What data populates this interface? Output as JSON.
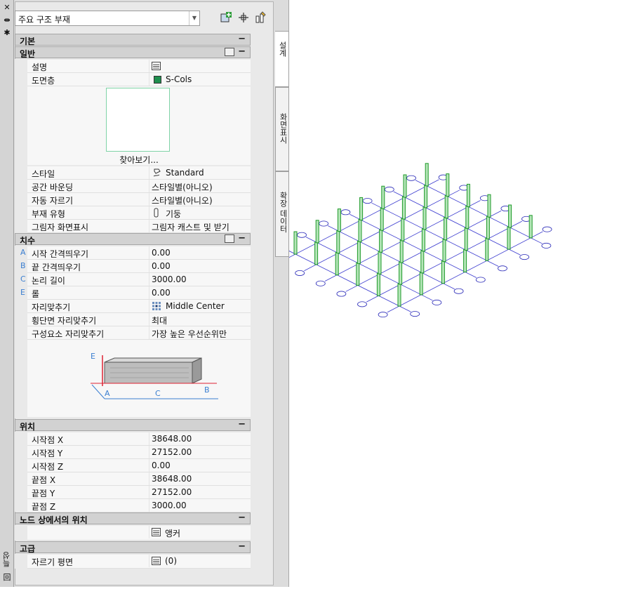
{
  "titlebar": {
    "close": "✕",
    "pin": "⇹",
    "settings": "✱",
    "title": "특성",
    "bottom_icon": "回"
  },
  "toolbar": {
    "object_type": "주요 구조 부재",
    "add_icon": "add-object-icon",
    "select_icon": "quick-select-icon",
    "pick_icon": "pick-add-icon"
  },
  "tabs": [
    {
      "label": "설계"
    },
    {
      "label": "화면표시"
    },
    {
      "label": "확장 데이터"
    }
  ],
  "sections": {
    "basic": "기본",
    "general": "일반",
    "dimensions": "치수",
    "location": "위치",
    "node_location": "노드 상에서의 위치",
    "advanced": "고급"
  },
  "general_rows": [
    {
      "key": "설명",
      "value": ""
    },
    {
      "key": "도면층",
      "value": "S-Cols",
      "color": "#1e8f4e"
    }
  ],
  "preview": {
    "browse": "찾아보기..."
  },
  "general_rows2": [
    {
      "key": "스타일",
      "value": "Standard"
    },
    {
      "key": "공간 바운딩",
      "value": "스타일별(아니오)"
    },
    {
      "key": "자동 자르기",
      "value": "스타일별(아니오)"
    },
    {
      "key": "부재 유형",
      "value": "기둥"
    },
    {
      "key": "그림자 화면표시",
      "value": "그림자 캐스트 및 받기"
    }
  ],
  "dim_rows": [
    {
      "letter": "A",
      "key": "시작 간격띄우기",
      "value": "0.00"
    },
    {
      "letter": "B",
      "key": "끝 간격띄우기",
      "value": "0.00"
    },
    {
      "letter": "C",
      "key": "논리 길이",
      "value": "3000.00"
    },
    {
      "letter": "E",
      "key": "롤",
      "value": "0.00"
    },
    {
      "letter": "",
      "key": "자리맞추기",
      "value": "Middle Center"
    },
    {
      "letter": "",
      "key": "횡단면 자리맞추기",
      "value": "최대"
    },
    {
      "letter": "",
      "key": "구성요소 자리맞추기",
      "value": "가장 높은 우선순위만"
    }
  ],
  "diagram_labels": {
    "a": "A",
    "b": "B",
    "c": "C",
    "e": "E"
  },
  "location_rows": [
    {
      "key": "시작점 X",
      "value": "38648.00"
    },
    {
      "key": "시작점 Y",
      "value": "27152.00"
    },
    {
      "key": "시작점 Z",
      "value": "0.00"
    },
    {
      "key": "끝점 X",
      "value": "38648.00"
    },
    {
      "key": "끝점 Y",
      "value": "27152.00"
    },
    {
      "key": "끝점 Z",
      "value": "3000.00"
    }
  ],
  "node_rows": [
    {
      "key": "",
      "value": "앵커"
    }
  ],
  "advanced_rows": [
    {
      "key": "자르기 평면",
      "value": "(0)"
    }
  ],
  "colors": {
    "grid": "#3a3acf",
    "column": "#1f9a2a",
    "layer": "#1e8f4e",
    "bubble": "#2a2ab8"
  }
}
